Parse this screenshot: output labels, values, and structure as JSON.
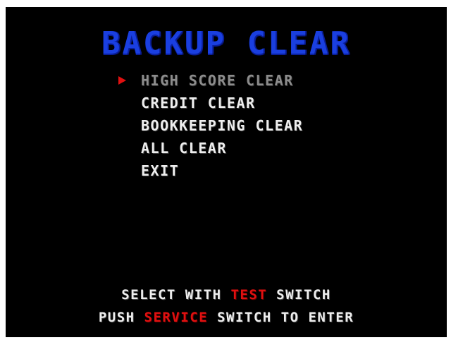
{
  "title": "BACKUP CLEAR",
  "menu": {
    "selected_index": 0,
    "items": [
      {
        "label": "HIGH SCORE CLEAR"
      },
      {
        "label": "CREDIT CLEAR"
      },
      {
        "label": "BOOKKEEPING CLEAR"
      },
      {
        "label": "ALL CLEAR"
      },
      {
        "label": "EXIT"
      }
    ]
  },
  "instructions": {
    "line1": {
      "before": "SELECT WITH ",
      "highlight": "TEST",
      "after": " SWITCH"
    },
    "line2": {
      "before": "PUSH ",
      "highlight": "SERVICE",
      "after": " SWITCH TO ENTER"
    }
  },
  "colors": {
    "background": "#000000",
    "title": "#1a3fe0",
    "menu_text": "#eeeeee",
    "selected_text": "#8c8c8c",
    "highlight": "#e01010",
    "cursor": "#e01010"
  },
  "icons": {
    "cursor": "red-triangle-arrow-icon"
  }
}
